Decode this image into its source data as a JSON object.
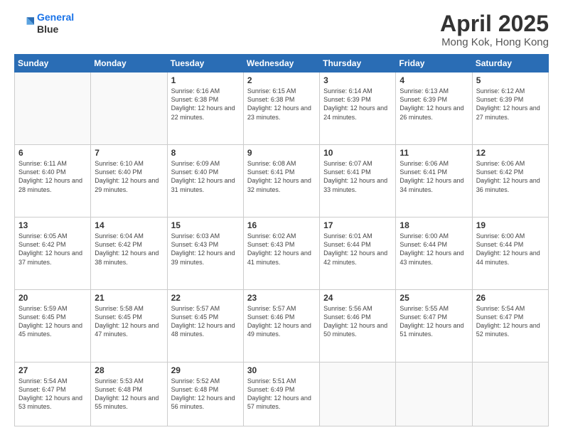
{
  "logo": {
    "line1": "General",
    "line2": "Blue"
  },
  "title": "April 2025",
  "subtitle": "Mong Kok, Hong Kong",
  "days_of_week": [
    "Sunday",
    "Monday",
    "Tuesday",
    "Wednesday",
    "Thursday",
    "Friday",
    "Saturday"
  ],
  "weeks": [
    [
      {
        "day": "",
        "sunrise": "",
        "sunset": "",
        "daylight": ""
      },
      {
        "day": "",
        "sunrise": "",
        "sunset": "",
        "daylight": ""
      },
      {
        "day": "1",
        "sunrise": "Sunrise: 6:16 AM",
        "sunset": "Sunset: 6:38 PM",
        "daylight": "Daylight: 12 hours and 22 minutes."
      },
      {
        "day": "2",
        "sunrise": "Sunrise: 6:15 AM",
        "sunset": "Sunset: 6:38 PM",
        "daylight": "Daylight: 12 hours and 23 minutes."
      },
      {
        "day": "3",
        "sunrise": "Sunrise: 6:14 AM",
        "sunset": "Sunset: 6:39 PM",
        "daylight": "Daylight: 12 hours and 24 minutes."
      },
      {
        "day": "4",
        "sunrise": "Sunrise: 6:13 AM",
        "sunset": "Sunset: 6:39 PM",
        "daylight": "Daylight: 12 hours and 26 minutes."
      },
      {
        "day": "5",
        "sunrise": "Sunrise: 6:12 AM",
        "sunset": "Sunset: 6:39 PM",
        "daylight": "Daylight: 12 hours and 27 minutes."
      }
    ],
    [
      {
        "day": "6",
        "sunrise": "Sunrise: 6:11 AM",
        "sunset": "Sunset: 6:40 PM",
        "daylight": "Daylight: 12 hours and 28 minutes."
      },
      {
        "day": "7",
        "sunrise": "Sunrise: 6:10 AM",
        "sunset": "Sunset: 6:40 PM",
        "daylight": "Daylight: 12 hours and 29 minutes."
      },
      {
        "day": "8",
        "sunrise": "Sunrise: 6:09 AM",
        "sunset": "Sunset: 6:40 PM",
        "daylight": "Daylight: 12 hours and 31 minutes."
      },
      {
        "day": "9",
        "sunrise": "Sunrise: 6:08 AM",
        "sunset": "Sunset: 6:41 PM",
        "daylight": "Daylight: 12 hours and 32 minutes."
      },
      {
        "day": "10",
        "sunrise": "Sunrise: 6:07 AM",
        "sunset": "Sunset: 6:41 PM",
        "daylight": "Daylight: 12 hours and 33 minutes."
      },
      {
        "day": "11",
        "sunrise": "Sunrise: 6:06 AM",
        "sunset": "Sunset: 6:41 PM",
        "daylight": "Daylight: 12 hours and 34 minutes."
      },
      {
        "day": "12",
        "sunrise": "Sunrise: 6:06 AM",
        "sunset": "Sunset: 6:42 PM",
        "daylight": "Daylight: 12 hours and 36 minutes."
      }
    ],
    [
      {
        "day": "13",
        "sunrise": "Sunrise: 6:05 AM",
        "sunset": "Sunset: 6:42 PM",
        "daylight": "Daylight: 12 hours and 37 minutes."
      },
      {
        "day": "14",
        "sunrise": "Sunrise: 6:04 AM",
        "sunset": "Sunset: 6:42 PM",
        "daylight": "Daylight: 12 hours and 38 minutes."
      },
      {
        "day": "15",
        "sunrise": "Sunrise: 6:03 AM",
        "sunset": "Sunset: 6:43 PM",
        "daylight": "Daylight: 12 hours and 39 minutes."
      },
      {
        "day": "16",
        "sunrise": "Sunrise: 6:02 AM",
        "sunset": "Sunset: 6:43 PM",
        "daylight": "Daylight: 12 hours and 41 minutes."
      },
      {
        "day": "17",
        "sunrise": "Sunrise: 6:01 AM",
        "sunset": "Sunset: 6:44 PM",
        "daylight": "Daylight: 12 hours and 42 minutes."
      },
      {
        "day": "18",
        "sunrise": "Sunrise: 6:00 AM",
        "sunset": "Sunset: 6:44 PM",
        "daylight": "Daylight: 12 hours and 43 minutes."
      },
      {
        "day": "19",
        "sunrise": "Sunrise: 6:00 AM",
        "sunset": "Sunset: 6:44 PM",
        "daylight": "Daylight: 12 hours and 44 minutes."
      }
    ],
    [
      {
        "day": "20",
        "sunrise": "Sunrise: 5:59 AM",
        "sunset": "Sunset: 6:45 PM",
        "daylight": "Daylight: 12 hours and 45 minutes."
      },
      {
        "day": "21",
        "sunrise": "Sunrise: 5:58 AM",
        "sunset": "Sunset: 6:45 PM",
        "daylight": "Daylight: 12 hours and 47 minutes."
      },
      {
        "day": "22",
        "sunrise": "Sunrise: 5:57 AM",
        "sunset": "Sunset: 6:45 PM",
        "daylight": "Daylight: 12 hours and 48 minutes."
      },
      {
        "day": "23",
        "sunrise": "Sunrise: 5:57 AM",
        "sunset": "Sunset: 6:46 PM",
        "daylight": "Daylight: 12 hours and 49 minutes."
      },
      {
        "day": "24",
        "sunrise": "Sunrise: 5:56 AM",
        "sunset": "Sunset: 6:46 PM",
        "daylight": "Daylight: 12 hours and 50 minutes."
      },
      {
        "day": "25",
        "sunrise": "Sunrise: 5:55 AM",
        "sunset": "Sunset: 6:47 PM",
        "daylight": "Daylight: 12 hours and 51 minutes."
      },
      {
        "day": "26",
        "sunrise": "Sunrise: 5:54 AM",
        "sunset": "Sunset: 6:47 PM",
        "daylight": "Daylight: 12 hours and 52 minutes."
      }
    ],
    [
      {
        "day": "27",
        "sunrise": "Sunrise: 5:54 AM",
        "sunset": "Sunset: 6:47 PM",
        "daylight": "Daylight: 12 hours and 53 minutes."
      },
      {
        "day": "28",
        "sunrise": "Sunrise: 5:53 AM",
        "sunset": "Sunset: 6:48 PM",
        "daylight": "Daylight: 12 hours and 55 minutes."
      },
      {
        "day": "29",
        "sunrise": "Sunrise: 5:52 AM",
        "sunset": "Sunset: 6:48 PM",
        "daylight": "Daylight: 12 hours and 56 minutes."
      },
      {
        "day": "30",
        "sunrise": "Sunrise: 5:51 AM",
        "sunset": "Sunset: 6:49 PM",
        "daylight": "Daylight: 12 hours and 57 minutes."
      },
      {
        "day": "",
        "sunrise": "",
        "sunset": "",
        "daylight": ""
      },
      {
        "day": "",
        "sunrise": "",
        "sunset": "",
        "daylight": ""
      },
      {
        "day": "",
        "sunrise": "",
        "sunset": "",
        "daylight": ""
      }
    ]
  ]
}
